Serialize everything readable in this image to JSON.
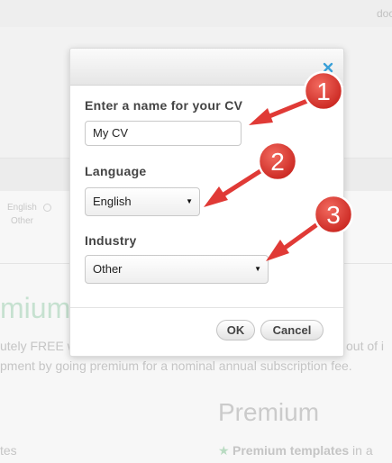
{
  "background": {
    "user_name": "doc",
    "language_options": [
      "English",
      "Other"
    ],
    "heading_partial": "mium",
    "text_line1_left": "utely FREE w",
    "text_line1_right": "out of i",
    "text_line2": "pment by going premium for a nominal annual subscription fee.",
    "premium_heading": "Premium",
    "templates_partial": "tes",
    "premium_templates_bold": "Premium templates",
    "premium_templates_rest": " in a"
  },
  "dialog": {
    "name_label": "Enter a name for your CV",
    "name_value": "My CV",
    "language_label": "Language",
    "language_value": "English",
    "industry_label": "Industry",
    "industry_value": "Other",
    "ok_label": "OK",
    "cancel_label": "Cancel"
  },
  "callouts": [
    {
      "number": "1"
    },
    {
      "number": "2"
    },
    {
      "number": "3"
    }
  ],
  "colors": {
    "callout_red": "#e03a36",
    "close_x": "#3aa0d8",
    "accent_green": "#8fd3a6"
  }
}
